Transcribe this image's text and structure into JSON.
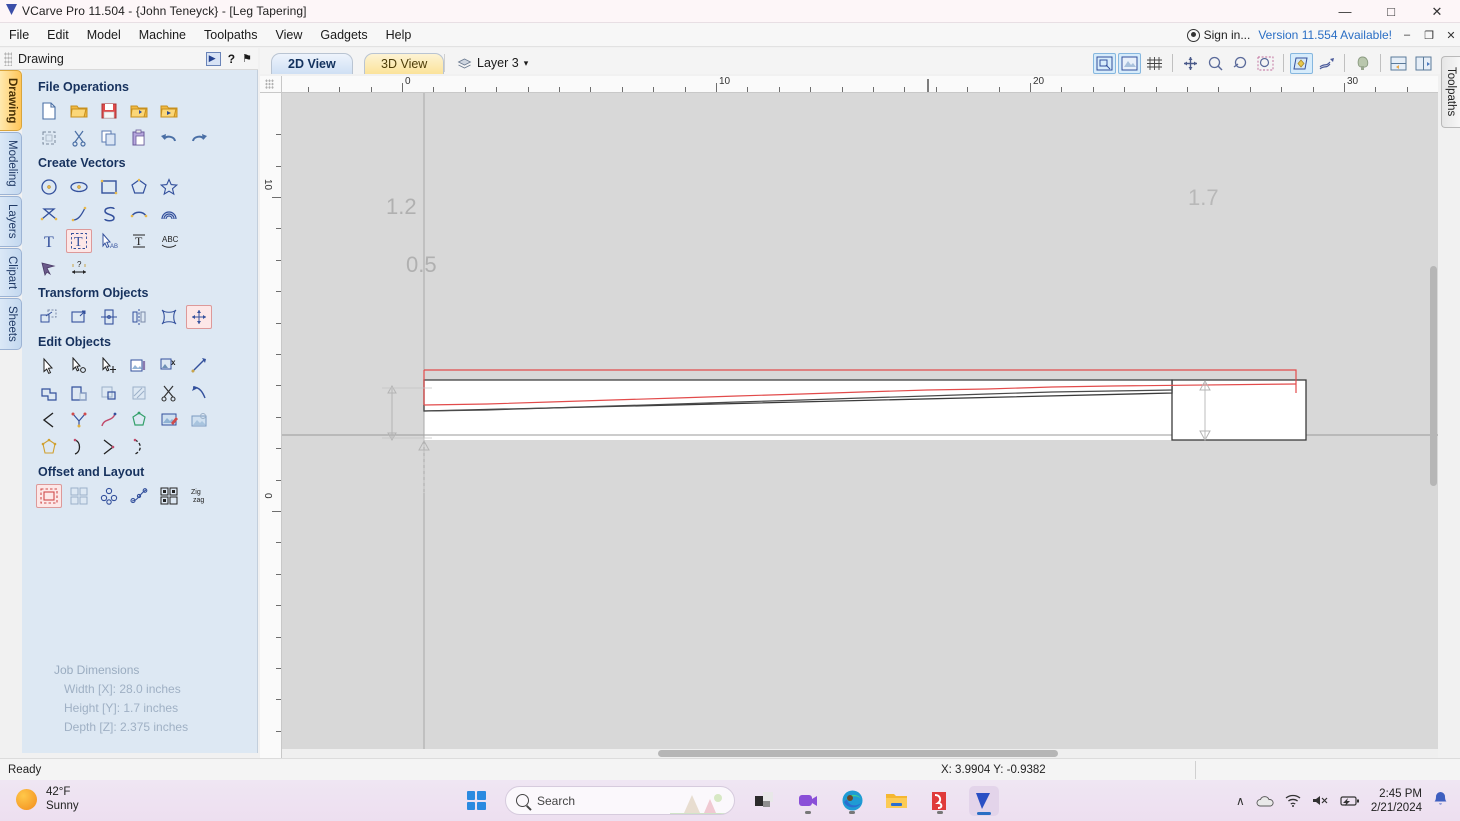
{
  "window": {
    "title": "VCarve Pro 11.504 - {John Teneyck} - [Leg Tapering]",
    "logo_icon": "vectric-logo-icon",
    "minimize": "—",
    "maximize": "□",
    "close": "✕"
  },
  "menu": {
    "items": [
      {
        "label": "File"
      },
      {
        "label": "Edit"
      },
      {
        "label": "Model"
      },
      {
        "label": "Machine"
      },
      {
        "label": "Toolpaths"
      },
      {
        "label": "View"
      },
      {
        "label": "Gadgets"
      },
      {
        "label": "Help"
      }
    ],
    "sign_in": "Sign in...",
    "version_notice": "Version 11.554 Available!",
    "min": "–",
    "restore": "❐",
    "close": "✕"
  },
  "panel": {
    "header_title": "Drawing",
    "help_icon": "?",
    "pin_icon": "⚑",
    "expand_icon": "panel-expand-icon",
    "vertical_tabs": [
      {
        "label": "Drawing",
        "active": true
      },
      {
        "label": "Modeling",
        "active": false
      },
      {
        "label": "Layers",
        "active": false
      },
      {
        "label": "Clipart",
        "active": false
      },
      {
        "label": "Sheets",
        "active": false
      }
    ],
    "sections": [
      {
        "title": "File Operations"
      },
      {
        "title": "Create Vectors"
      },
      {
        "title": "Transform Objects"
      },
      {
        "title": "Edit Objects"
      },
      {
        "title": "Offset and Layout"
      }
    ]
  },
  "job_dimensions": {
    "title": "Job Dimensions",
    "width": "Width  [X]: 28.0 inches",
    "height": "Height [Y]: 1.7 inches",
    "depth": "Depth  [Z]: 2.375 inches"
  },
  "view_tabs": {
    "tab_2d": "2D View",
    "tab_3d": "3D View",
    "layer_label": "Layer 3",
    "layer_caret": "▾",
    "layer_icon": "layer-icon"
  },
  "right_tab": {
    "label": "Toolpaths"
  },
  "rulers": {
    "horizontal_labels": [
      "0",
      "10",
      "20",
      "30"
    ],
    "horizontal_positions": [
      402,
      716,
      1030,
      1345
    ],
    "vertical_labels": [
      "10",
      "0"
    ],
    "vertical_positions": [
      120,
      435
    ],
    "units_per_tick": 31.4
  },
  "drawing": {
    "dimension_left_vertical": "1.2",
    "dimension_left_horizontal": "0.5",
    "dimension_right_vertical": "1.7",
    "outline_color": "#3b3b3b",
    "offset_vector_color": "#e24b4b",
    "canvas_color": "#d8d8d8",
    "material_color": "#ffffff"
  },
  "statusbar": {
    "status": "Ready",
    "coordinates": "X: 3.9904 Y: -0.9382"
  },
  "taskbar": {
    "weather_temp": "42°F",
    "weather_cond": "Sunny",
    "search_placeholder": "Search",
    "start_icon": "windows-start-icon",
    "apps": [
      {
        "name": "copilot-icon"
      },
      {
        "name": "teams-icon"
      },
      {
        "name": "edge-icon"
      },
      {
        "name": "file-explorer-icon"
      },
      {
        "name": "sketchup-icon"
      },
      {
        "name": "vcarve-icon"
      }
    ],
    "tray": {
      "chevron": "∧",
      "onedrive_icon": "onedrive-icon",
      "wifi_icon": "wifi-icon",
      "volume_icon": "volume-muted-icon",
      "battery_icon": "battery-icon",
      "time": "2:45 PM",
      "date": "2/21/2024",
      "bell": "🔔"
    }
  }
}
